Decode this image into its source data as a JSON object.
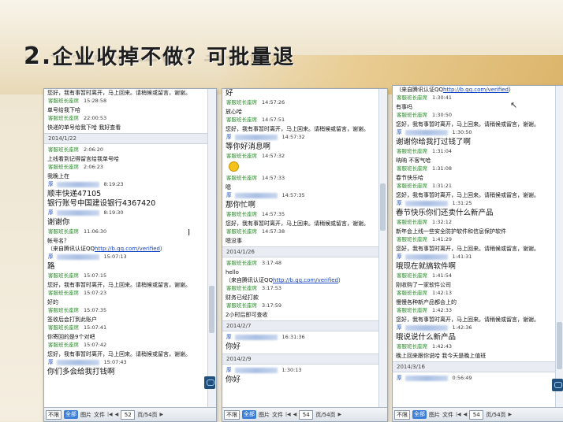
{
  "slide": {
    "title_num": "2.",
    "title_text": "企业收掉不做？可批量退"
  },
  "panels": [
    {
      "messages": [
        {
          "type": "text",
          "text": "您好，我有事暂时离开，马上回来。请稍候或留言，谢谢。"
        },
        {
          "type": "sender",
          "name": "客服班长座席",
          "time": "15:28:58"
        },
        {
          "type": "text",
          "text": "单号给我下哈"
        },
        {
          "type": "sender",
          "name": "客服班长座席",
          "time": "22:00:53"
        },
        {
          "type": "text",
          "text": "快递的单号给我下哈 我好查看"
        },
        {
          "type": "date",
          "text": "2014/1/22"
        },
        {
          "type": "sender",
          "name": "客服班长座席",
          "time": "2:06:20"
        },
        {
          "type": "text",
          "text": "上线看到记得留言给我单号哈"
        },
        {
          "type": "sender",
          "name": "客服班长座席",
          "time": "2:06:23"
        },
        {
          "type": "text",
          "text": "我晚上在"
        },
        {
          "type": "sender",
          "name": "厚",
          "time": "8:19:23",
          "blue": true
        },
        {
          "type": "text",
          "text": "顺丰快递47105",
          "big": true
        },
        {
          "type": "text",
          "text": "银行账号中国建设银行4367420",
          "big": true
        },
        {
          "type": "sender",
          "name": "厚",
          "time": "8:19:30",
          "blue": true
        },
        {
          "type": "text",
          "text": "谢谢你",
          "big": true
        },
        {
          "type": "sender",
          "name": "客服班长座席",
          "time": "11:06:30"
        },
        {
          "type": "text",
          "text": "帐号名？"
        },
        {
          "type": "text",
          "text": "（来自腾讯认证QQ",
          "link": "http://b.qq.com/verified",
          "after": "）"
        },
        {
          "type": "sender",
          "name": "厚",
          "time": "15:07:13",
          "blue": true
        },
        {
          "type": "text",
          "text": "路",
          "big": true
        },
        {
          "type": "sender",
          "name": "客服班长座席",
          "time": "15:07:15"
        },
        {
          "type": "text",
          "text": "您好，我有事暂时离开，马上回来。请稍候或留言，谢谢。"
        },
        {
          "type": "sender",
          "name": "客服班长座席",
          "time": "15:07:23"
        },
        {
          "type": "text",
          "text": "好的"
        },
        {
          "type": "sender",
          "name": "客服班长座席",
          "time": "15:07:35"
        },
        {
          "type": "text",
          "text": "签收后会打到此账户"
        },
        {
          "type": "sender",
          "name": "客服班长座席",
          "time": "15:07:41"
        },
        {
          "type": "text",
          "text": "你寄回的是9个对吧"
        },
        {
          "type": "sender",
          "name": "客服班长座席",
          "time": "15:07:42"
        },
        {
          "type": "text",
          "text": "您好，我有事暂时离开，马上回来。请稍候或留言，谢谢。"
        },
        {
          "type": "sender",
          "name": "厚",
          "time": "15:07:43",
          "blue": true
        },
        {
          "type": "text",
          "text": "你们多会给我打钱啊",
          "big": true
        }
      ],
      "bar": {
        "select": "不限",
        "all": "全部",
        "image": "图片",
        "file": "文件",
        "page": "52",
        "total": "页/54页"
      }
    },
    {
      "messages": [
        {
          "type": "text",
          "text": "好",
          "big": true
        },
        {
          "type": "sender",
          "name": "客服班长座席",
          "time": "14:57:26"
        },
        {
          "type": "text",
          "text": "放心哈"
        },
        {
          "type": "sender",
          "name": "客服班长座席",
          "time": "14:57:51"
        },
        {
          "type": "text",
          "text": "您好，我有事暂时离开，马上回来。请稍候或留言，谢谢。"
        },
        {
          "type": "sender",
          "name": "厚",
          "time": "14:57:32",
          "blue": true
        },
        {
          "type": "text",
          "text": "等你好消息啊",
          "big": true
        },
        {
          "type": "sender",
          "name": "客服班长座席",
          "time": "14:57:32"
        },
        {
          "type": "smile"
        },
        {
          "type": "sender",
          "name": "客服班长座席",
          "time": "14:57:33"
        },
        {
          "type": "text",
          "text": "嗯"
        },
        {
          "type": "sender",
          "name": "厚",
          "time": "14:57:35",
          "blue": true
        },
        {
          "type": "text",
          "text": "那你忙啊",
          "big": true
        },
        {
          "type": "sender",
          "name": "客服班长座席",
          "time": "14:57:35"
        },
        {
          "type": "text",
          "text": "您好，我有事暂时离开，马上回来。请稍候或留言，谢谢。"
        },
        {
          "type": "sender",
          "name": "客服班长座席",
          "time": "14:57:38"
        },
        {
          "type": "text",
          "text": "嗯没事"
        },
        {
          "type": "date",
          "text": "2014/1/26"
        },
        {
          "type": "sender",
          "name": "客服班长座席",
          "time": "3:17:48"
        },
        {
          "type": "text",
          "text": "hello"
        },
        {
          "type": "text",
          "text": "（来自腾讯认证QQ",
          "link": "http://b.qq.com/verified",
          "after": "）"
        },
        {
          "type": "sender",
          "name": "客服班长座席",
          "time": "3:17:53"
        },
        {
          "type": "text",
          "text": "财务已经打款"
        },
        {
          "type": "sender",
          "name": "客服班长座席",
          "time": "3:17:59"
        },
        {
          "type": "text",
          "text": "2小时后即可查收"
        },
        {
          "type": "date",
          "text": "2014/2/7"
        },
        {
          "type": "sender",
          "name": "厚",
          "time": "16:31:36",
          "blue": true
        },
        {
          "type": "text",
          "text": "你好",
          "big": true
        },
        {
          "type": "date",
          "text": "2014/2/9"
        },
        {
          "type": "sender",
          "name": "厚",
          "time": "1:30:13",
          "blue": true
        },
        {
          "type": "text",
          "text": "你好",
          "big": true
        }
      ],
      "bar": {
        "select": "不限",
        "all": "全部",
        "image": "图片",
        "file": "文件",
        "page": "54",
        "total": "页/54页"
      }
    },
    {
      "messages": [
        {
          "type": "text",
          "text": "（来自腾讯认证QQ",
          "link": "http://b.qq.com/verified",
          "after": "）"
        },
        {
          "type": "sender",
          "name": "客服班长座席",
          "time": "1:30:41"
        },
        {
          "type": "text",
          "text": "有事吗"
        },
        {
          "type": "sender",
          "name": "客服班长座席",
          "time": "1:30:50"
        },
        {
          "type": "text",
          "text": "您好，我有事暂时离开，马上回来。请稍候或留言，谢谢。"
        },
        {
          "type": "sender",
          "name": "厚",
          "time": "1:30:50",
          "blue": true
        },
        {
          "type": "text",
          "text": "谢谢你给我打过钱了啊",
          "big": true
        },
        {
          "type": "sender",
          "name": "客服班长座席",
          "time": "1:31:04"
        },
        {
          "type": "text",
          "text": "呐呐 不客气哈"
        },
        {
          "type": "sender",
          "name": "客服班长座席",
          "time": "1:31:08"
        },
        {
          "type": "text",
          "text": "春节快乐哈"
        },
        {
          "type": "sender",
          "name": "客服班长座席",
          "time": "1:31:21"
        },
        {
          "type": "text",
          "text": "您好，我有事暂时离开，马上回来。请稍候或留言，谢谢。"
        },
        {
          "type": "sender",
          "name": "厚",
          "time": "1:31:25",
          "blue": true
        },
        {
          "type": "text",
          "text": "春节快乐你们还卖什么新产品",
          "big": true
        },
        {
          "type": "sender",
          "name": "客服班长座席",
          "time": "1:32:12"
        },
        {
          "type": "text",
          "text": "新年会上线一些安全防护软件和信息保护软件"
        },
        {
          "type": "sender",
          "name": "客服班长座席",
          "time": "1:41:29"
        },
        {
          "type": "text",
          "text": "您好，我有事暂时离开，马上回来。请稍候或留言，谢谢。"
        },
        {
          "type": "sender",
          "name": "厚",
          "time": "1:41:31",
          "blue": true
        },
        {
          "type": "text",
          "text": "哦现在就搞软件啊",
          "big": true
        },
        {
          "type": "sender",
          "name": "客服班长座席",
          "time": "1:41:54"
        },
        {
          "type": "text",
          "text": "刚收购了一家软件公司"
        },
        {
          "type": "sender",
          "name": "客服班长座席",
          "time": "1:42:13"
        },
        {
          "type": "text",
          "text": "慢慢各种新产品都会上的"
        },
        {
          "type": "sender",
          "name": "客服班长座席",
          "time": "1:42:33"
        },
        {
          "type": "text",
          "text": "您好，我有事暂时离开，马上回来。请稍候或留言，谢谢。"
        },
        {
          "type": "sender",
          "name": "厚",
          "time": "1:42:36",
          "blue": true
        },
        {
          "type": "text",
          "text": "哦说说什么新产品",
          "big": true
        },
        {
          "type": "sender",
          "name": "客服班长座席",
          "time": "1:42:43"
        },
        {
          "type": "text",
          "text": "晚上回来跟你说哈 我今天是晚上值班"
        },
        {
          "type": "date",
          "text": "2014/3/16"
        },
        {
          "type": "sender",
          "name": "厚",
          "time": "0:56:49",
          "blue": true
        }
      ],
      "bar": {
        "select": "不限",
        "all": "全部",
        "image": "图片",
        "file": "文件",
        "page": "54",
        "total": "页/54页"
      }
    }
  ],
  "icons": {
    "cursor_text": "I",
    "cursor_arrow": "↖",
    "nav_left": "◀",
    "nav_right": "▶",
    "nav_first": "|◀",
    "nav_last": "▶|"
  }
}
